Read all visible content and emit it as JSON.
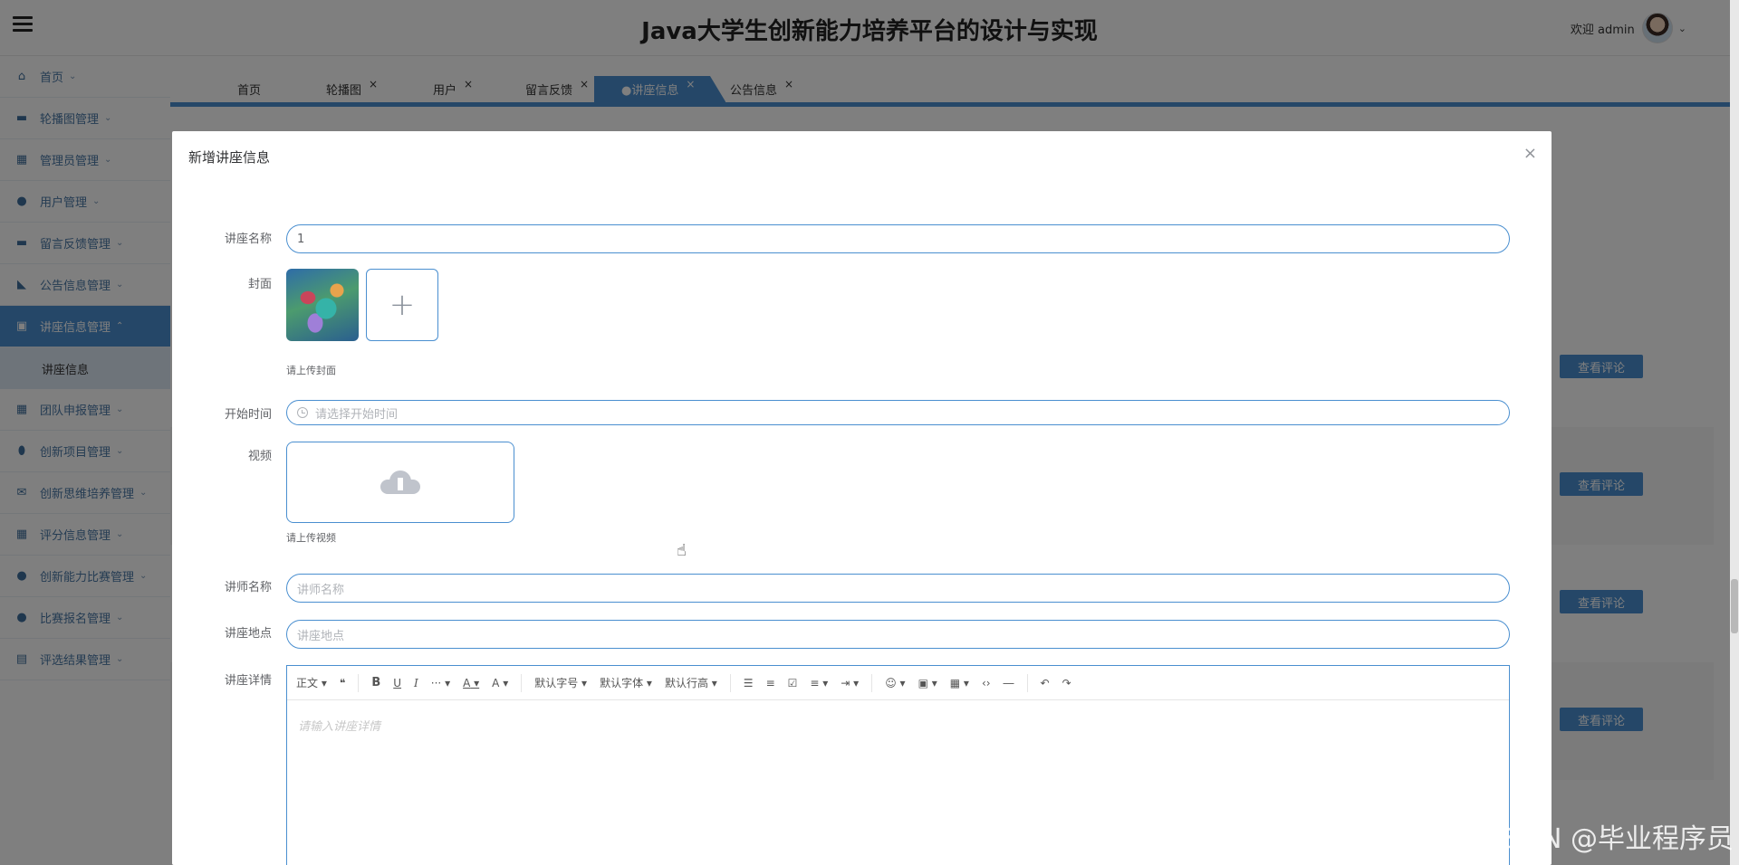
{
  "header": {
    "title": "Java大学生创新能力培养平台的设计与实现",
    "welcome": "欢迎 admin"
  },
  "sidebar": {
    "items": [
      {
        "label": "首页",
        "icon": "home-icon"
      },
      {
        "label": "轮播图管理",
        "icon": "image-icon"
      },
      {
        "label": "管理员管理",
        "icon": "grid-icon"
      },
      {
        "label": "用户管理",
        "icon": "user-icon"
      },
      {
        "label": "留言反馈管理",
        "icon": "message-icon"
      },
      {
        "label": "公告信息管理",
        "icon": "notice-icon"
      },
      {
        "label": "讲座信息管理",
        "icon": "book-icon",
        "active": true
      },
      {
        "label": "团队申报管理",
        "icon": "team-icon"
      },
      {
        "label": "创新项目管理",
        "icon": "project-icon"
      },
      {
        "label": "创新思维培养管理",
        "icon": "mail-icon"
      },
      {
        "label": "评分信息管理",
        "icon": "score-icon"
      },
      {
        "label": "创新能力比赛管理",
        "icon": "trophy-icon"
      },
      {
        "label": "比赛报名管理",
        "icon": "drop-icon"
      },
      {
        "label": "评选结果管理",
        "icon": "result-icon"
      }
    ],
    "subitem": "讲座信息"
  },
  "tabs": [
    {
      "label": "首页",
      "closable": false
    },
    {
      "label": "轮播图",
      "closable": true
    },
    {
      "label": "用户",
      "closable": true
    },
    {
      "label": "留言反馈",
      "closable": true
    },
    {
      "label": "●讲座信息",
      "closable": true,
      "active": true
    },
    {
      "label": "公告信息",
      "closable": true
    }
  ],
  "background": {
    "view_comment_button": "查看评论"
  },
  "dialog": {
    "title": "新增讲座信息",
    "close": "×",
    "fields": {
      "name": {
        "label": "讲座名称",
        "value": "1"
      },
      "cover": {
        "label": "封面",
        "hint": "请上传封面"
      },
      "start_time": {
        "label": "开始时间",
        "placeholder": "请选择开始时间"
      },
      "video": {
        "label": "视频",
        "hint": "请上传视频"
      },
      "teacher": {
        "label": "讲师名称",
        "placeholder": "讲师名称"
      },
      "location": {
        "label": "讲座地点",
        "placeholder": "讲座地点"
      },
      "detail": {
        "label": "讲座详情",
        "placeholder": "请输入讲座详情"
      }
    },
    "toolbar": {
      "paragraph": "正文",
      "quote": "❝",
      "bold": "B",
      "underline": "U",
      "italic": "I",
      "more": "···",
      "font_color": "A",
      "bg_color": "A",
      "font_size": "默认字号",
      "font_family": "默认字体",
      "line_height": "默认行高",
      "bullet_list": "☰",
      "numbered_list": "≡",
      "todo": "☑",
      "align": "≡",
      "indent": "⇥",
      "emoji": "☺",
      "image": "▣",
      "table": "▦",
      "code": "‹›",
      "divider": "―",
      "undo": "↶",
      "redo": "↷"
    }
  },
  "watermark": "CSDN @毕业程序员"
}
